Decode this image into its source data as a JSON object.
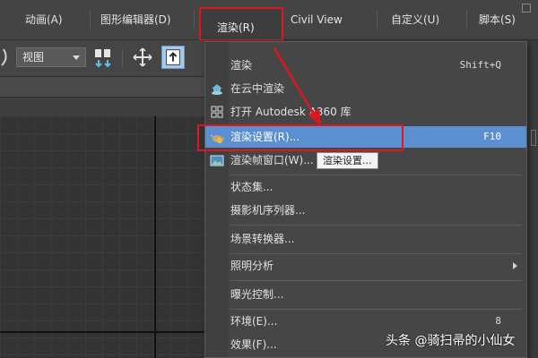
{
  "menubar": {
    "items": [
      {
        "label": "动画(A)"
      },
      {
        "label": "图形编辑器(D)"
      },
      {
        "label": "渲染(R)"
      },
      {
        "label": "Civil View"
      },
      {
        "label": "自定义(U)"
      },
      {
        "label": "脚本(S)"
      }
    ]
  },
  "toolbar": {
    "view_select": "视图"
  },
  "render_menu": {
    "items": [
      {
        "label": "渲染",
        "shortcut": "Shift+Q"
      },
      {
        "label": "在云中渲染",
        "shortcut": ""
      },
      {
        "label": "打开 Autodesk A360 库",
        "shortcut": ""
      },
      {
        "label": "渲染设置(R)...",
        "shortcut": "F10"
      },
      {
        "label": "渲染帧窗口(W)...",
        "shortcut": "",
        "button": "渲染设置..."
      },
      {
        "label": "状态集...",
        "shortcut": ""
      },
      {
        "label": "摄影机序列器...",
        "shortcut": ""
      },
      {
        "label": "场景转换器...",
        "shortcut": ""
      },
      {
        "label": "照明分析",
        "shortcut": ""
      },
      {
        "label": "曝光控制...",
        "shortcut": ""
      },
      {
        "label": "环境(E)...",
        "shortcut": "8"
      },
      {
        "label": "效果(F)...",
        "shortcut": ""
      }
    ]
  },
  "watermark": "头条 @骑扫帚的小仙女",
  "colors": {
    "highlight": "#5c8fd0",
    "annotation_red": "#e0161e",
    "menu_bg": "#464646"
  }
}
